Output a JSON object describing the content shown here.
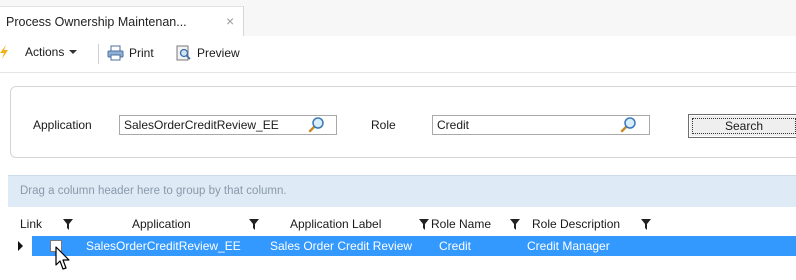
{
  "tab": {
    "title": "Process Ownership Maintenan...",
    "close": "×"
  },
  "toolbar": {
    "actions_label": "Actions",
    "print_label": "Print",
    "preview_label": "Preview"
  },
  "filters": {
    "application_label": "Application",
    "application_value": "SalesOrderCreditReview_EE",
    "role_label": "Role",
    "role_value": "Credit",
    "search_label": "Search"
  },
  "grid": {
    "group_hint": "Drag a column header here to group by that column.",
    "columns": [
      "Link",
      "Application",
      "Application Label",
      "Role Name",
      "Role Description"
    ],
    "rows": [
      {
        "link_checked": false,
        "application": "SalesOrderCreditReview_EE",
        "application_label": "Sales Order Credit Review",
        "role_name": "Credit",
        "role_description": "Credit Manager",
        "selected": true
      }
    ]
  },
  "colors": {
    "selection": "#3399ff",
    "group_panel": "#deeaf6",
    "actions_icon": "#f0b020"
  },
  "icons": [
    "close-icon",
    "lightning-icon",
    "dropdown-arrow-icon",
    "printer-icon",
    "preview-icon",
    "magnifier-icon",
    "filter-icon",
    "row-indicator-icon",
    "mouse-cursor-icon"
  ]
}
